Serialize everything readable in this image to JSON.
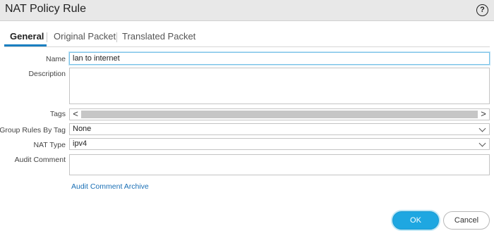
{
  "dialog": {
    "title": "NAT Policy Rule",
    "help_glyph": "?"
  },
  "tabs": [
    {
      "label": "General",
      "active": true
    },
    {
      "label": "Original Packet",
      "active": false
    },
    {
      "label": "Translated Packet",
      "active": false
    }
  ],
  "form": {
    "name": {
      "label": "Name",
      "value": "lan to internet"
    },
    "description": {
      "label": "Description",
      "value": ""
    },
    "tags": {
      "label": "Tags",
      "left_arrow": "<",
      "right_arrow": ">"
    },
    "group_rules_by_tag": {
      "label": "Group Rules By Tag",
      "value": "None"
    },
    "nat_type": {
      "label": "NAT Type",
      "value": "ipv4"
    },
    "audit_comment": {
      "label": "Audit Comment",
      "value": ""
    },
    "audit_archive_link": "Audit Comment Archive"
  },
  "buttons": {
    "ok": "OK",
    "cancel": "Cancel"
  },
  "colors": {
    "accent": "#1ea7e1",
    "tab_underline": "#1a7fc1",
    "link": "#1a6fb5",
    "titlebar": "#e8e8e8"
  }
}
